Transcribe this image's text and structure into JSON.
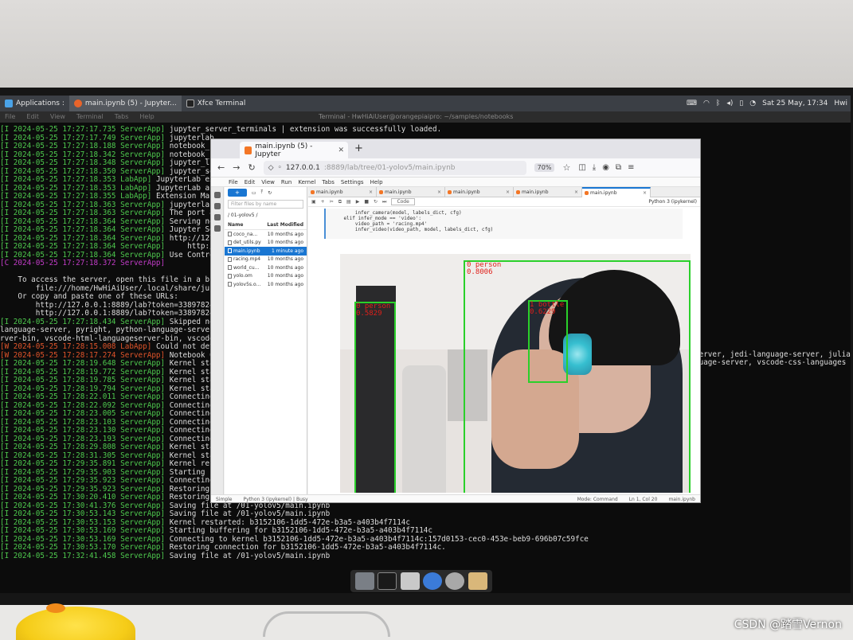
{
  "taskbar": {
    "applications_label": "Applications :",
    "task_browser": "main.ipynb (5) - Jupyter...",
    "task_terminal": "Xfce Terminal",
    "clock": "Sat 25 May, 17:34",
    "user_short": "Hwi"
  },
  "terminal": {
    "title": "Terminal - HwHiAiUser@orangepiaipro: ~/samples/notebooks",
    "menu": [
      "File",
      "Edit",
      "View",
      "Terminal",
      "Tabs",
      "Help"
    ],
    "lines": [
      {
        "lvl": "I",
        "ts": "2024-05-25 17:27:17.735",
        "src": "ServerApp]",
        "msg": "jupyter_server_terminals | extension was successfully loaded."
      },
      {
        "lvl": "I",
        "ts": "2024-05-25 17:27:17.749",
        "src": "ServerApp]",
        "msg": "jupyterlab"
      },
      {
        "lvl": "I",
        "ts": "2024-05-25 17:27:18.188",
        "src": "ServerApp]",
        "msg": "notebook_sh"
      },
      {
        "lvl": "I",
        "ts": "2024-05-25 17:27:18.342",
        "src": "ServerApp]",
        "msg": "notebook_sh"
      },
      {
        "lvl": "I",
        "ts": "2024-05-25 17:27:18.348",
        "src": "ServerApp]",
        "msg": "jupyter_lsp"
      },
      {
        "lvl": "I",
        "ts": "2024-05-25 17:27:18.350",
        "src": "ServerApp]",
        "msg": "jupyter_ser"
      },
      {
        "lvl": "I",
        "ts": "2024-05-25 17:27:18.353",
        "src": "LabApp]",
        "msg": "JupyterLab ext"
      },
      {
        "lvl": "I",
        "ts": "2024-05-25 17:27:18.353",
        "src": "LabApp]",
        "msg": "JupyterLab app"
      },
      {
        "lvl": "I",
        "ts": "2024-05-25 17:27:18.355",
        "src": "LabApp]",
        "msg": "Extension Mana"
      },
      {
        "lvl": "I",
        "ts": "2024-05-25 17:27:18.363",
        "src": "ServerApp]",
        "msg": "jupyterlab"
      },
      {
        "lvl": "I",
        "ts": "2024-05-25 17:27:18.363",
        "src": "ServerApp]",
        "msg": "The port 88"
      },
      {
        "lvl": "I",
        "ts": "2024-05-25 17:27:18.364",
        "src": "ServerApp]",
        "msg": "Serving not"
      },
      {
        "lvl": "I",
        "ts": "2024-05-25 17:27:18.364",
        "src": "ServerApp]",
        "msg": "Jupyter Se"
      },
      {
        "lvl": "I",
        "ts": "2024-05-25 17:27:18.364",
        "src": "ServerApp]",
        "msg": "http://127"
      },
      {
        "lvl": "I",
        "ts": "2024-05-25 17:27:18.364",
        "src": "ServerApp]",
        "msg": "    http://"
      },
      {
        "lvl": "I",
        "ts": "2024-05-25 17:27:18.364",
        "src": "ServerApp]",
        "msg": "Use Control"
      },
      {
        "lvl": "C",
        "ts": "2024-05-25 17:27:18.372",
        "src": "ServerApp]",
        "msg": ""
      },
      {
        "lvl": "",
        "ts": "",
        "src": "",
        "msg": ""
      },
      {
        "lvl": "",
        "ts": "",
        "src": "",
        "msg": "    To access the server, open this file in a bro"
      },
      {
        "lvl": "",
        "ts": "",
        "src": "",
        "msg": "        file:///home/HwHiAiUser/.local/share/jupy"
      },
      {
        "lvl": "",
        "ts": "",
        "src": "",
        "msg": "    Or copy and paste one of these URLs:"
      },
      {
        "lvl": "",
        "ts": "",
        "src": "",
        "msg": "        http://127.0.0.1:8889/lab?token=33897824a"
      },
      {
        "lvl": "",
        "ts": "",
        "src": "",
        "msg": "        http://127.0.0.1:8889/lab?token=33897824a"
      },
      {
        "lvl": "I",
        "ts": "2024-05-25 17:27:18.434",
        "src": "ServerApp]",
        "msg": "Skipped non"
      },
      {
        "lvl": "",
        "ts": "",
        "src": "",
        "msg": "language-server, pyright, python-language-server,"
      },
      {
        "lvl": "",
        "ts": "",
        "src": "",
        "msg": "rver-bin, vscode-html-languageserver-bin, vscode"
      },
      {
        "lvl": "W",
        "ts": "2024-05-25 17:28:15.008",
        "src": "LabApp]",
        "msg": "Could not dete"
      },
      {
        "lvl": "W",
        "ts": "2024-05-25 17:28:17.274",
        "src": "ServerApp]",
        "msg": "Notebook 09"
      },
      {
        "lvl": "I",
        "ts": "2024-05-25 17:28:19.648",
        "src": "ServerApp]",
        "msg": "Kernel star"
      },
      {
        "lvl": "I",
        "ts": "2024-05-25 17:28:19.772",
        "src": "ServerApp]",
        "msg": "Kernel star"
      },
      {
        "lvl": "I",
        "ts": "2024-05-25 17:28:19.785",
        "src": "ServerApp]",
        "msg": "Kernel star"
      },
      {
        "lvl": "I",
        "ts": "2024-05-25 17:28:19.794",
        "src": "ServerApp]",
        "msg": "Kernel star"
      },
      {
        "lvl": "I",
        "ts": "2024-05-25 17:28:22.011",
        "src": "ServerApp]",
        "msg": "Connecting"
      },
      {
        "lvl": "I",
        "ts": "2024-05-25 17:28:22.092",
        "src": "ServerApp]",
        "msg": "Connecting"
      },
      {
        "lvl": "I",
        "ts": "2024-05-25 17:28:23.005",
        "src": "ServerApp]",
        "msg": "Connecting"
      },
      {
        "lvl": "I",
        "ts": "2024-05-25 17:28:23.103",
        "src": "ServerApp]",
        "msg": "Connecting"
      },
      {
        "lvl": "I",
        "ts": "2024-05-25 17:28:23.130",
        "src": "ServerApp]",
        "msg": "Connecting"
      },
      {
        "lvl": "I",
        "ts": "2024-05-25 17:28:23.193",
        "src": "ServerApp]",
        "msg": "Connecting"
      },
      {
        "lvl": "I",
        "ts": "2024-05-25 17:28:29.808",
        "src": "ServerApp]",
        "msg": "Kernel star"
      },
      {
        "lvl": "I",
        "ts": "2024-05-25 17:28:31.305",
        "src": "ServerApp]",
        "msg": "Kernel star"
      },
      {
        "lvl": "I",
        "ts": "2024-05-25 17:29:35.891",
        "src": "ServerApp]",
        "msg": "Kernel rest"
      },
      {
        "lvl": "I",
        "ts": "2024-05-25 17:29:35.903",
        "src": "ServerApp]",
        "msg": "Starting buffering for b3152106-1dd5-472e-b3a5-a403b4f7114c"
      },
      {
        "lvl": "I",
        "ts": "2024-05-25 17:29:35.923",
        "src": "ServerApp]",
        "msg": "Connecting to kernel b3152106-1dd5-472e-b3a5-a403b4f7114c:157d0153-cec0-453e-beb9-696b07c59fce"
      },
      {
        "lvl": "I",
        "ts": "2024-05-25 17:29:35.923",
        "src": "ServerApp]",
        "msg": "Restoring connection for b3152106-1dd5-472e-b3a5-a403b4f7114c."
      },
      {
        "lvl": "I",
        "ts": "2024-05-25 17:30:20.410",
        "src": "ServerApp]",
        "msg": "Restoring connection for b3152106-1dd5-472e-b3a5-a403b4f7114c:157d0153-cec0-453e-beb9-696b07c59fce"
      },
      {
        "lvl": "I",
        "ts": "2024-05-25 17:30:41.376",
        "src": "ServerApp]",
        "msg": "Saving file at /01-yolov5/main.ipynb"
      },
      {
        "lvl": "I",
        "ts": "2024-05-25 17:30:53.143",
        "src": "ServerApp]",
        "msg": "Saving file at /01-yolov5/main.ipynb"
      },
      {
        "lvl": "I",
        "ts": "2024-05-25 17:30:53.153",
        "src": "ServerApp]",
        "msg": "Kernel restarted: b3152106-1dd5-472e-b3a5-a403b4f7114c"
      },
      {
        "lvl": "I",
        "ts": "2024-05-25 17:30:53.169",
        "src": "ServerApp]",
        "msg": "Starting buffering for b3152106-1dd5-472e-b3a5-a403b4f7114c"
      },
      {
        "lvl": "I",
        "ts": "2024-05-25 17:30:53.169",
        "src": "ServerApp]",
        "msg": "Connecting to kernel b3152106-1dd5-472e-b3a5-a403b4f7114c:157d0153-cec0-453e-beb9-696b07c59fce"
      },
      {
        "lvl": "I",
        "ts": "2024-05-25 17:30:53.170",
        "src": "ServerApp]",
        "msg": "Restoring connection for b3152106-1dd5-472e-b3a5-a403b4f7114c."
      },
      {
        "lvl": "I",
        "ts": "2024-05-25 17:32:41.458",
        "src": "ServerApp]",
        "msg": "Saving file at /01-yolov5/main.ipynb"
      }
    ],
    "right_fragment_1": "server, jedi-language-server, julia",
    "right_fragment_2": "guage-server, vscode-css-languages"
  },
  "browser": {
    "tab_title": "main.ipynb (5) - Jupyter",
    "url_host": "127.0.0.1",
    "url_path": ":8889/lab/tree/01-yolov5/main.ipynb",
    "zoom": "70%"
  },
  "jupyter": {
    "menu": [
      "File",
      "Edit",
      "View",
      "Run",
      "Kernel",
      "Tabs",
      "Settings",
      "Help"
    ],
    "new_button": "+",
    "filter_placeholder": "Filter files by name",
    "breadcrumb": "/ 01-yolov5 /",
    "col_name": "Name",
    "col_modified": "Last Modified",
    "files": [
      {
        "name": "coco_na...",
        "modified": "10 months ago",
        "selected": false
      },
      {
        "name": "det_utils.py",
        "modified": "10 months ago",
        "selected": false
      },
      {
        "name": "main.ipynb",
        "modified": "1 minute ago",
        "selected": true
      },
      {
        "name": "racing.mp4",
        "modified": "10 months ago",
        "selected": false
      },
      {
        "name": "world_cu...",
        "modified": "10 months ago",
        "selected": false
      },
      {
        "name": "yolo.om",
        "modified": "10 months ago",
        "selected": false
      },
      {
        "name": "yolov5s.o...",
        "modified": "10 months ago",
        "selected": false
      }
    ],
    "tabs": [
      "main.ipynb",
      "main.ipynb",
      "main.ipynb",
      "main.ipynb",
      "main.ipynb"
    ],
    "cell_type": "Code",
    "kernel_name": "Python 3 (ipykernel)",
    "code_lines": [
      "        infer_camera(model, labels_dict, cfg)",
      "    elif infer_mode == 'video':",
      "        video_path = 'racing.mp4'",
      "        infer_video(video_path, model, labels_dict, cfg)"
    ],
    "status_left": "Simple",
    "status_kernel": "Python 3 (ipykernel) | Busy",
    "status_mode": "Mode: Command",
    "status_pos": "Ln 1, Col 20",
    "status_file": "main.ipynb"
  },
  "detections": [
    {
      "label": "0 person",
      "score": "0.8006"
    },
    {
      "label": "0 person",
      "score": "0.5829"
    },
    {
      "label": "1 bottle",
      "score": "0.6229"
    }
  ],
  "watermark": "CSDN @踏雪Vernon"
}
